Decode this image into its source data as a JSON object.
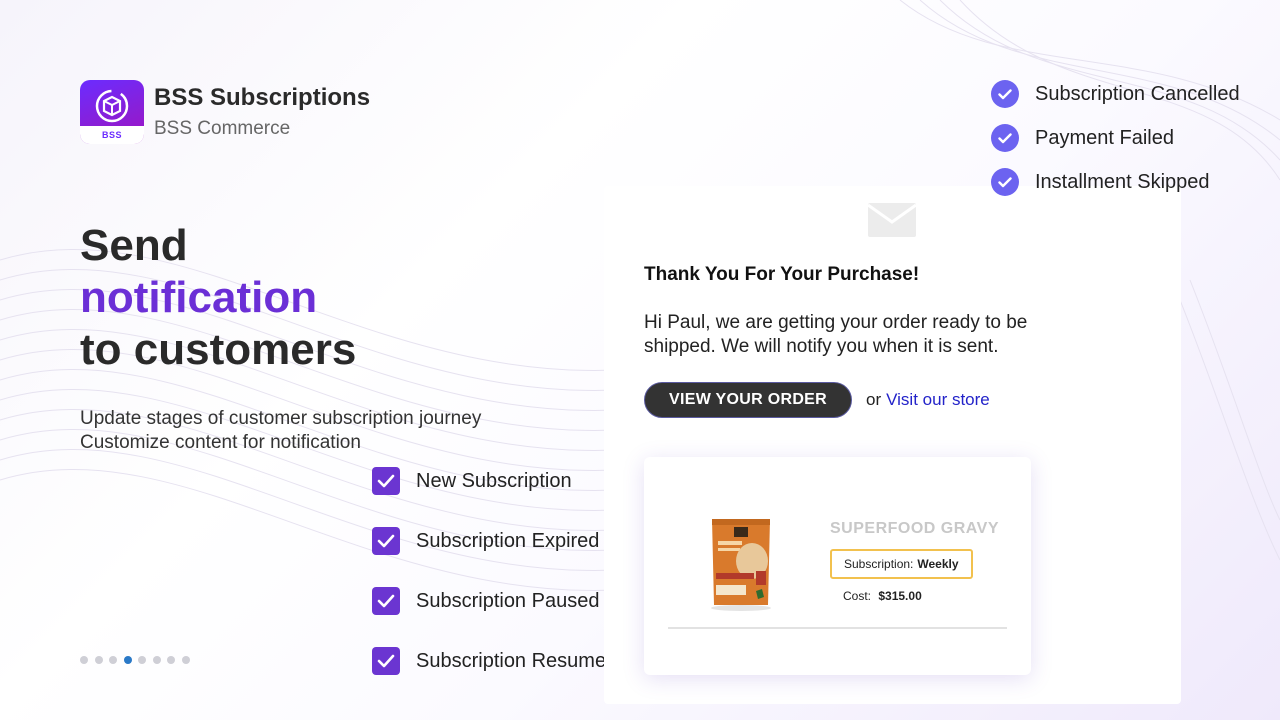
{
  "brand": {
    "name": "BSS Subscriptions",
    "company": "BSS Commerce",
    "logo_text": "BSS"
  },
  "headline": {
    "line1": "Send",
    "line2": "notification",
    "line3": "to customers"
  },
  "subtext": {
    "line1": "Update stages of customer subscription journey",
    "line2": "Customize content for notification"
  },
  "checklist": [
    {
      "label": "New Subscription",
      "checked": true
    },
    {
      "label": "Subscription Expired",
      "checked": true
    },
    {
      "label": "Subscription Paused",
      "checked": true
    },
    {
      "label": "Subscription Resumed",
      "checked": true
    }
  ],
  "right_checklist": [
    {
      "label": "Subscription Cancelled"
    },
    {
      "label": "Payment Failed"
    },
    {
      "label": "Installment Skipped"
    }
  ],
  "email": {
    "heading": "Thank You For Your Purchase!",
    "body": "Hi Paul, we are getting your order ready to be shipped. We will notify you when it is sent.",
    "button": "VIEW YOUR ORDER",
    "or": "or",
    "link": "Visit our store",
    "product": {
      "name": "SUPERFOOD GRAVY",
      "subscription_label": "Subscription:",
      "subscription_value": "Weekly",
      "cost_label": "Cost:",
      "cost_value": "$315.00"
    }
  },
  "pager": {
    "total": 8,
    "active_index": 3
  },
  "colors": {
    "accent_purple": "#6b2fd6",
    "check_purple": "#6b35d1",
    "circle_check": "#6c63f0",
    "button_dark": "#333333",
    "link_blue": "#2323c9",
    "badge_border": "#f2c14e",
    "dot_active": "#2a79c7"
  }
}
